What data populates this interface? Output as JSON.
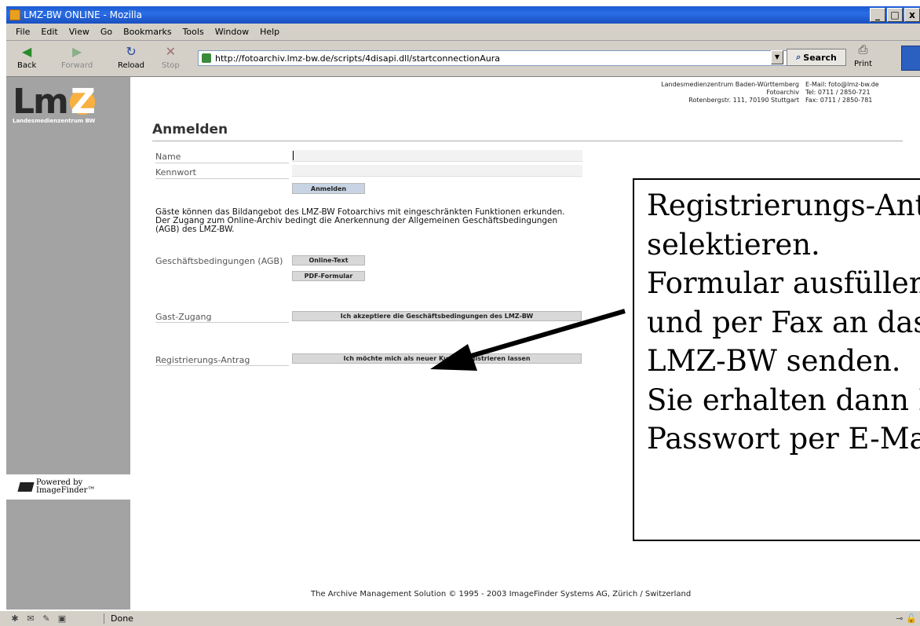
{
  "window": {
    "title": "LMZ-BW ONLINE - Mozilla",
    "min": "_",
    "max": "□",
    "close": "x"
  },
  "menu": [
    "File",
    "Edit",
    "View",
    "Go",
    "Bookmarks",
    "Tools",
    "Window",
    "Help"
  ],
  "toolbar": {
    "back": "Back",
    "forward": "Forward",
    "reload": "Reload",
    "stop": "Stop",
    "url": "http://fotoarchiv.lmz-bw.de/scripts/4disapi.dll/startconnectionAura",
    "search": "Search",
    "print": "Print"
  },
  "sidebar": {
    "logo_letters": "Lm",
    "logo_z": "Z",
    "logo_sub": "Landesmedienzentrum BW",
    "powered_line1": "Powered by",
    "powered_line2": "ImageFinder™"
  },
  "contact": {
    "org": "Landesmedienzentrum Baden-Württemberg",
    "dept": "Fotoarchiv",
    "address": "Rotenbergstr. 111, 70190 Stuttgart",
    "email": "E-Mail: foto@lmz-bw.de",
    "tel": "Tel: 0711 / 2850-721",
    "fax": "Fax: 0711 / 2850-781"
  },
  "login": {
    "heading": "Anmelden",
    "name_label": "Name",
    "password_label": "Kennwort",
    "submit": "Anmelden",
    "info": "Gäste können das Bildangebot des LMZ-BW Fotoarchivs mit eingeschränkten Funktionen erkunden. Der Zugang zum Online-Archiv bedingt die Anerkennung der Allgemeinen Geschäftsbedingungen (AGB) des LMZ-BW.",
    "agb_label": "Geschäftsbedingungen (AGB)",
    "agb_online": "Online-Text",
    "agb_pdf": "PDF-Formular",
    "guest_label": "Gast-Zugang",
    "guest_button": "Ich akzeptiere die Geschäftsbedingungen des LMZ-BW",
    "register_label": "Registrierungs-Antrag",
    "register_button": "Ich möchte mich als neuer Kunde registrieren lassen"
  },
  "footer": "The Archive Management Solution © 1995 - 2003 ImageFinder Systems AG, Zürich / Switzerland",
  "status": "Done",
  "callout": {
    "lines": [
      "Registrierungs-Antrag",
      "selektieren.",
      "Formular ausfüllen",
      "und per Fax an das",
      "LMZ-BW senden.",
      "Sie erhalten dann Ihr",
      "Passwort per E-Mail."
    ]
  }
}
